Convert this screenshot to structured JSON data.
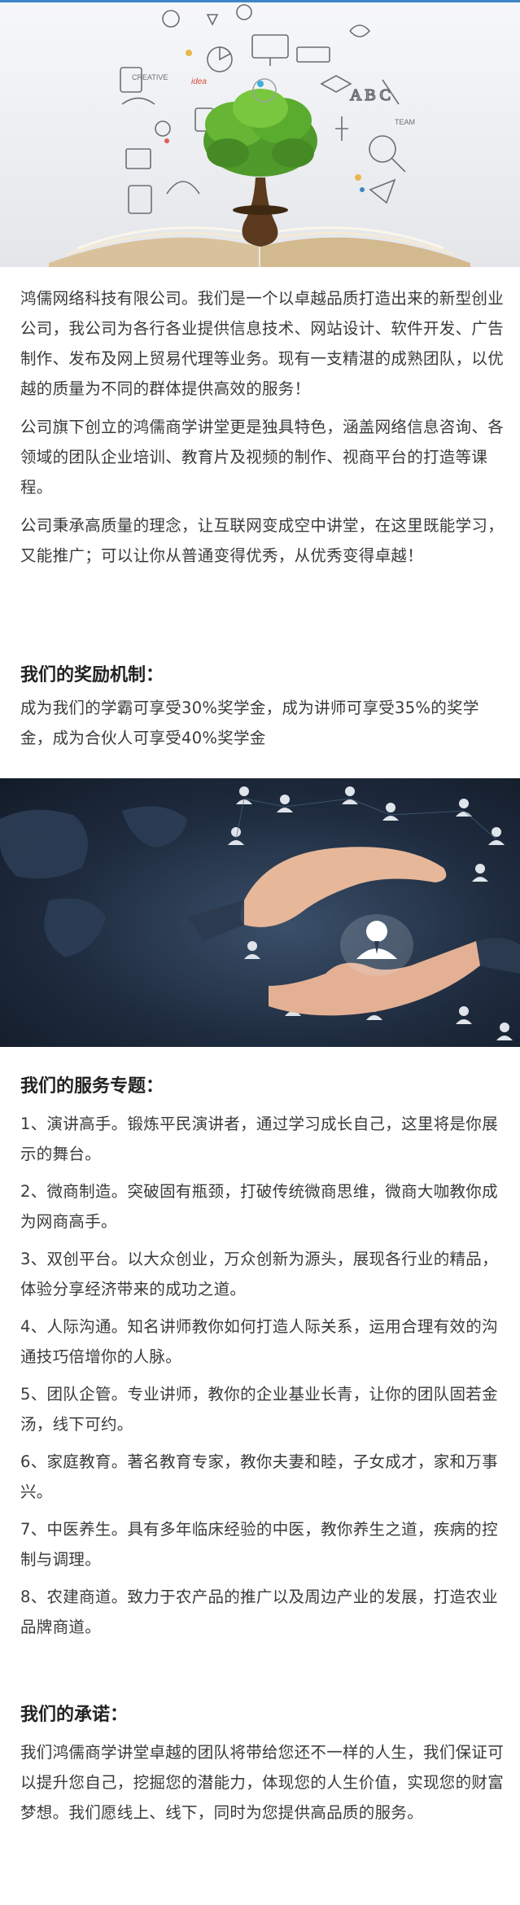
{
  "hero": {
    "doodle_words": [
      "CREATIVE",
      "idea",
      "TEAM"
    ],
    "image": "book-with-tree-and-doodle-icons"
  },
  "intro": {
    "paragraphs": [
      "鸿儒网络科技有限公司。我们是一个以卓越品质打造出来的新型创业公司，我公司为各行各业提供信息技术、网站设计、软件开发、广告制作、发布及网上贸易代理等业务。现有一支精湛的成熟团队，以优越的质量为不同的群体提供高效的服务！",
      "公司旗下创立的鸿儒商学讲堂更是独具特色，涵盖网络信息咨询、各领域的团队企业培训、教育片及视频的制作、视商平台的打造等课程。",
      "公司秉承高质量的理念，让互联网变成空中讲堂，在这里既能学习，又能推广；可以让你从普通变得优秀，从优秀变得卓越！"
    ]
  },
  "reward": {
    "heading": "我们的奖励机制：",
    "text": "成为我们的学霸可享受30%奖学金，成为讲师可享受35%的奖学金，成为合伙人可享受40%奖学金"
  },
  "banner": {
    "image": "hands-protecting-person-icon"
  },
  "services": {
    "heading": "我们的服务专题：",
    "items": [
      "1、演讲高手。锻炼平民演讲者，通过学习成长自己，这里将是你展示的舞台。",
      "2、微商制造。突破固有瓶颈，打破传统微商思维，微商大咖教你成为网商高手。",
      "3、双创平台。以大众创业，万众创新为源头，展现各行业的精品，体验分享经济带来的成功之道。",
      "4、人际沟通。知名讲师教你如何打造人际关系，运用合理有效的沟通技巧倍增你的人脉。",
      "5、团队企管。专业讲师，教你的企业基业长青，让你的团队固若金汤，线下可约。",
      "6、家庭教育。著名教育专家，教你夫妻和睦，子女成才，家和万事兴。",
      "7、中医养生。具有多年临床经验的中医，教你养生之道，疾病的控制与调理。",
      "8、农建商道。致力于农产品的推广以及周边产业的发展，打造农业品牌商道。"
    ]
  },
  "promise": {
    "heading": "我们的承诺：",
    "text": "我们鸿儒商学讲堂卓越的团队将带给您还不一样的人生，我们保证可以提升您自己，挖掘您的潜能力，体现您的人生价值，实现您的财富梦想。我们愿线上、线下，同时为您提供高品质的服务。"
  },
  "colors": {
    "accent_line": "#3d86c6",
    "text": "#3a3a3a",
    "heading": "#222222",
    "banner_bg": "#1f2c3f"
  }
}
